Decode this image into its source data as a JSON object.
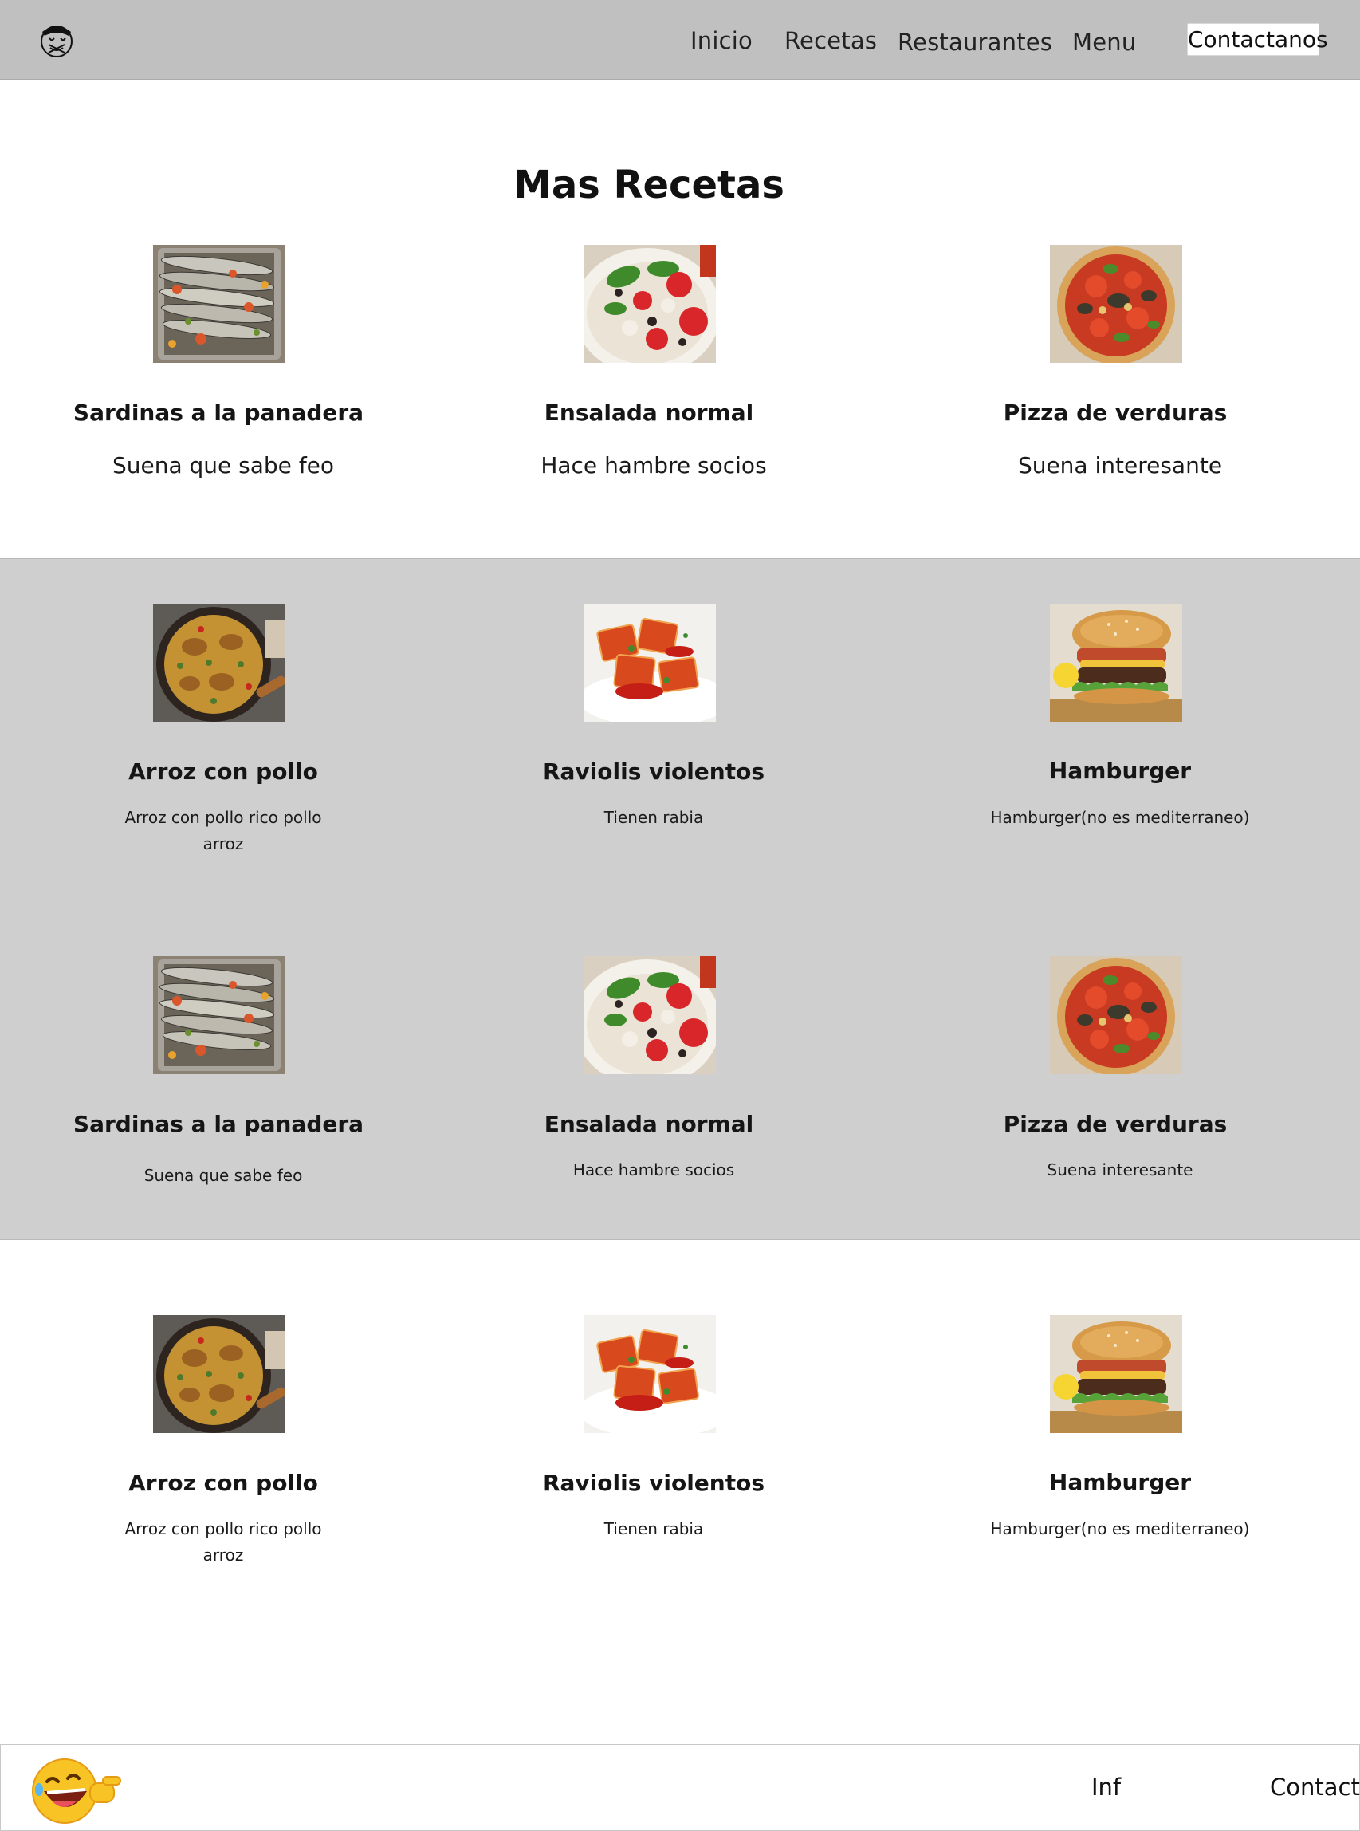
{
  "header": {
    "logo_icon": "chef-face-logo-icon",
    "nav": [
      "Inicio",
      "Recetas",
      "Restaurantes",
      "Menu"
    ],
    "contact_label": "Contactanos"
  },
  "section_title": "Mas Recetas",
  "row1": [
    {
      "image": "sardines-tray",
      "title": "Sardinas a la panadera",
      "desc": "Suena que sabe feo"
    },
    {
      "image": "tomato-salad",
      "title": "Ensalada normal",
      "desc": "Hace hambre socios"
    },
    {
      "image": "veggie-pizza",
      "title": "Pizza de verduras",
      "desc": "Suena interesante"
    }
  ],
  "row2": [
    {
      "image": "chicken-paella",
      "title": "Arroz con pollo",
      "desc": "Arroz con pollo rico pollo arroz"
    },
    {
      "image": "ravioli",
      "title": "Raviolis violentos",
      "desc": "Tienen rabia"
    },
    {
      "image": "bacon-burger",
      "title": "Hamburger",
      "desc": "Hamburger(no es mediterraneo)"
    }
  ],
  "row3": [
    {
      "image": "sardines-tray",
      "title": "Sardinas a la panadera",
      "desc": "Suena que sabe feo"
    },
    {
      "image": "tomato-salad",
      "title": "Ensalada normal",
      "desc": "Hace hambre socios"
    },
    {
      "image": "veggie-pizza",
      "title": "Pizza de verduras",
      "desc": "Suena interesante"
    }
  ],
  "row4": [
    {
      "image": "chicken-paella",
      "title": "Arroz con pollo",
      "desc": "Arroz con pollo rico pollo arroz"
    },
    {
      "image": "ravioli",
      "title": "Raviolis violentos",
      "desc": "Tienen rabia"
    },
    {
      "image": "bacon-burger",
      "title": "Hamburger",
      "desc": "Hamburger(no es mediterraneo)"
    }
  ],
  "footer": {
    "emoji_icon": "laughing-pointing-emoji-icon",
    "links": [
      "Inf",
      "Contact"
    ]
  },
  "colors": {
    "header_bg": "#c0c0c0",
    "band_bg": "#cfcfcf",
    "page_bg": "#ffffff"
  }
}
